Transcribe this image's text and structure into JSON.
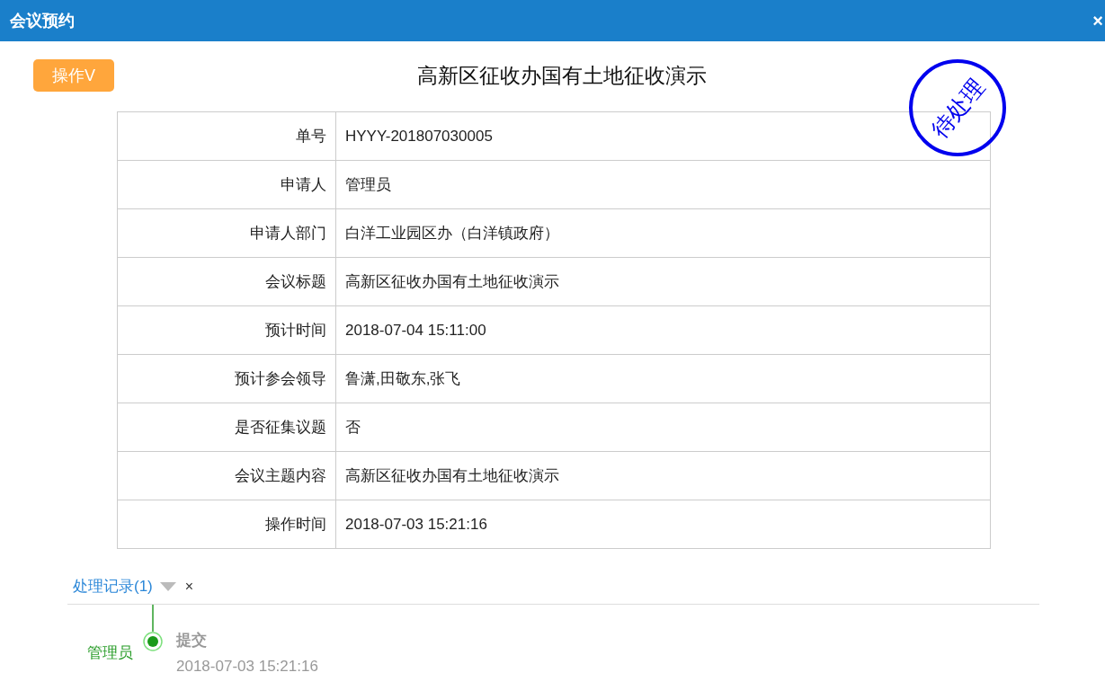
{
  "window": {
    "title": "会议预约",
    "close": "×"
  },
  "action_button": "操作V",
  "heading": "高新区征收办国有土地征收演示",
  "stamp": "待处理",
  "fields": [
    {
      "label": "单号",
      "value": "HYYY-201807030005"
    },
    {
      "label": "申请人",
      "value": "管理员"
    },
    {
      "label": "申请人部门",
      "value": "白洋工业园区办（白洋镇政府）"
    },
    {
      "label": "会议标题",
      "value": "高新区征收办国有土地征收演示"
    },
    {
      "label": "预计时间",
      "value": "2018-07-04 15:11:00"
    },
    {
      "label": "预计参会领导",
      "value": "鲁潇,田敬东,张飞"
    },
    {
      "label": "是否征集议题",
      "value": "否"
    },
    {
      "label": "会议主题内容",
      "value": "高新区征收办国有土地征收演示"
    },
    {
      "label": "操作时间",
      "value": "2018-07-03 15:21:16"
    }
  ],
  "records": {
    "title": "处理记录(1)",
    "expanded": true,
    "close": "×",
    "entries": [
      {
        "user": "管理员",
        "action": "提交",
        "time": "2018-07-03 15:21:16"
      }
    ]
  }
}
